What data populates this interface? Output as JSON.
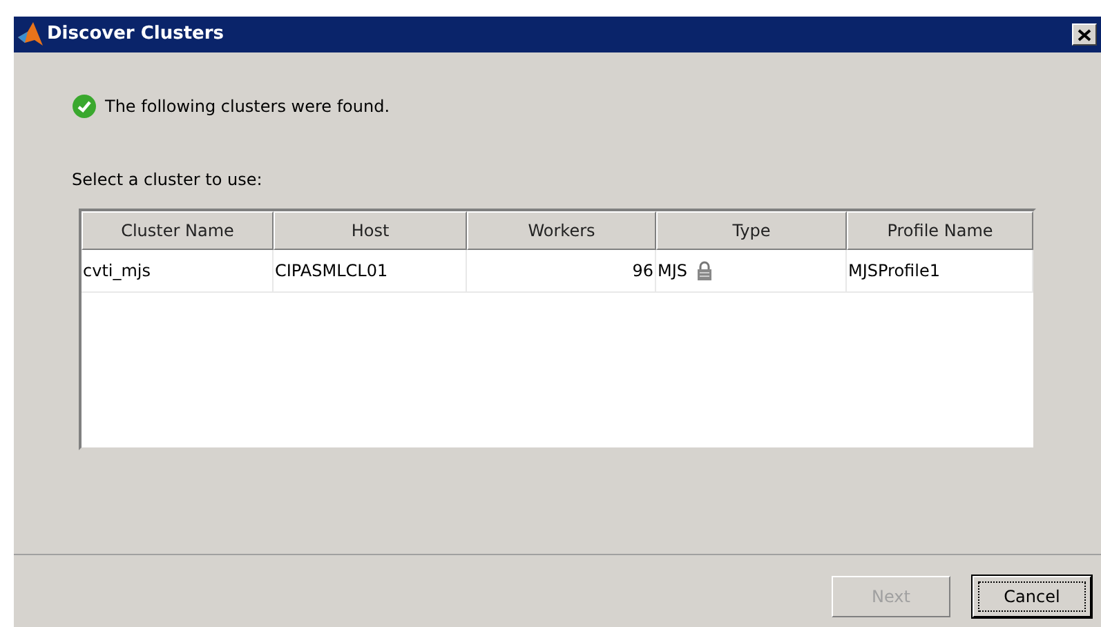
{
  "window": {
    "title": "Discover Clusters"
  },
  "status_message": "The following clusters were found.",
  "prompt": "Select a cluster to use:",
  "table": {
    "columns": [
      {
        "label": "Cluster Name"
      },
      {
        "label": "Host"
      },
      {
        "label": "Workers"
      },
      {
        "label": "Type"
      },
      {
        "label": "Profile Name"
      }
    ],
    "rows": [
      {
        "cells": [
          "cvti_mjs",
          "CIPASMLCL01",
          "96",
          "MJS",
          "MJSProfile1"
        ],
        "locked": true,
        "selected": false
      }
    ]
  },
  "buttons": [
    {
      "label": "Next",
      "disabled": true,
      "focused": false
    },
    {
      "label": "Cancel",
      "disabled": false,
      "focused": true
    }
  ]
}
